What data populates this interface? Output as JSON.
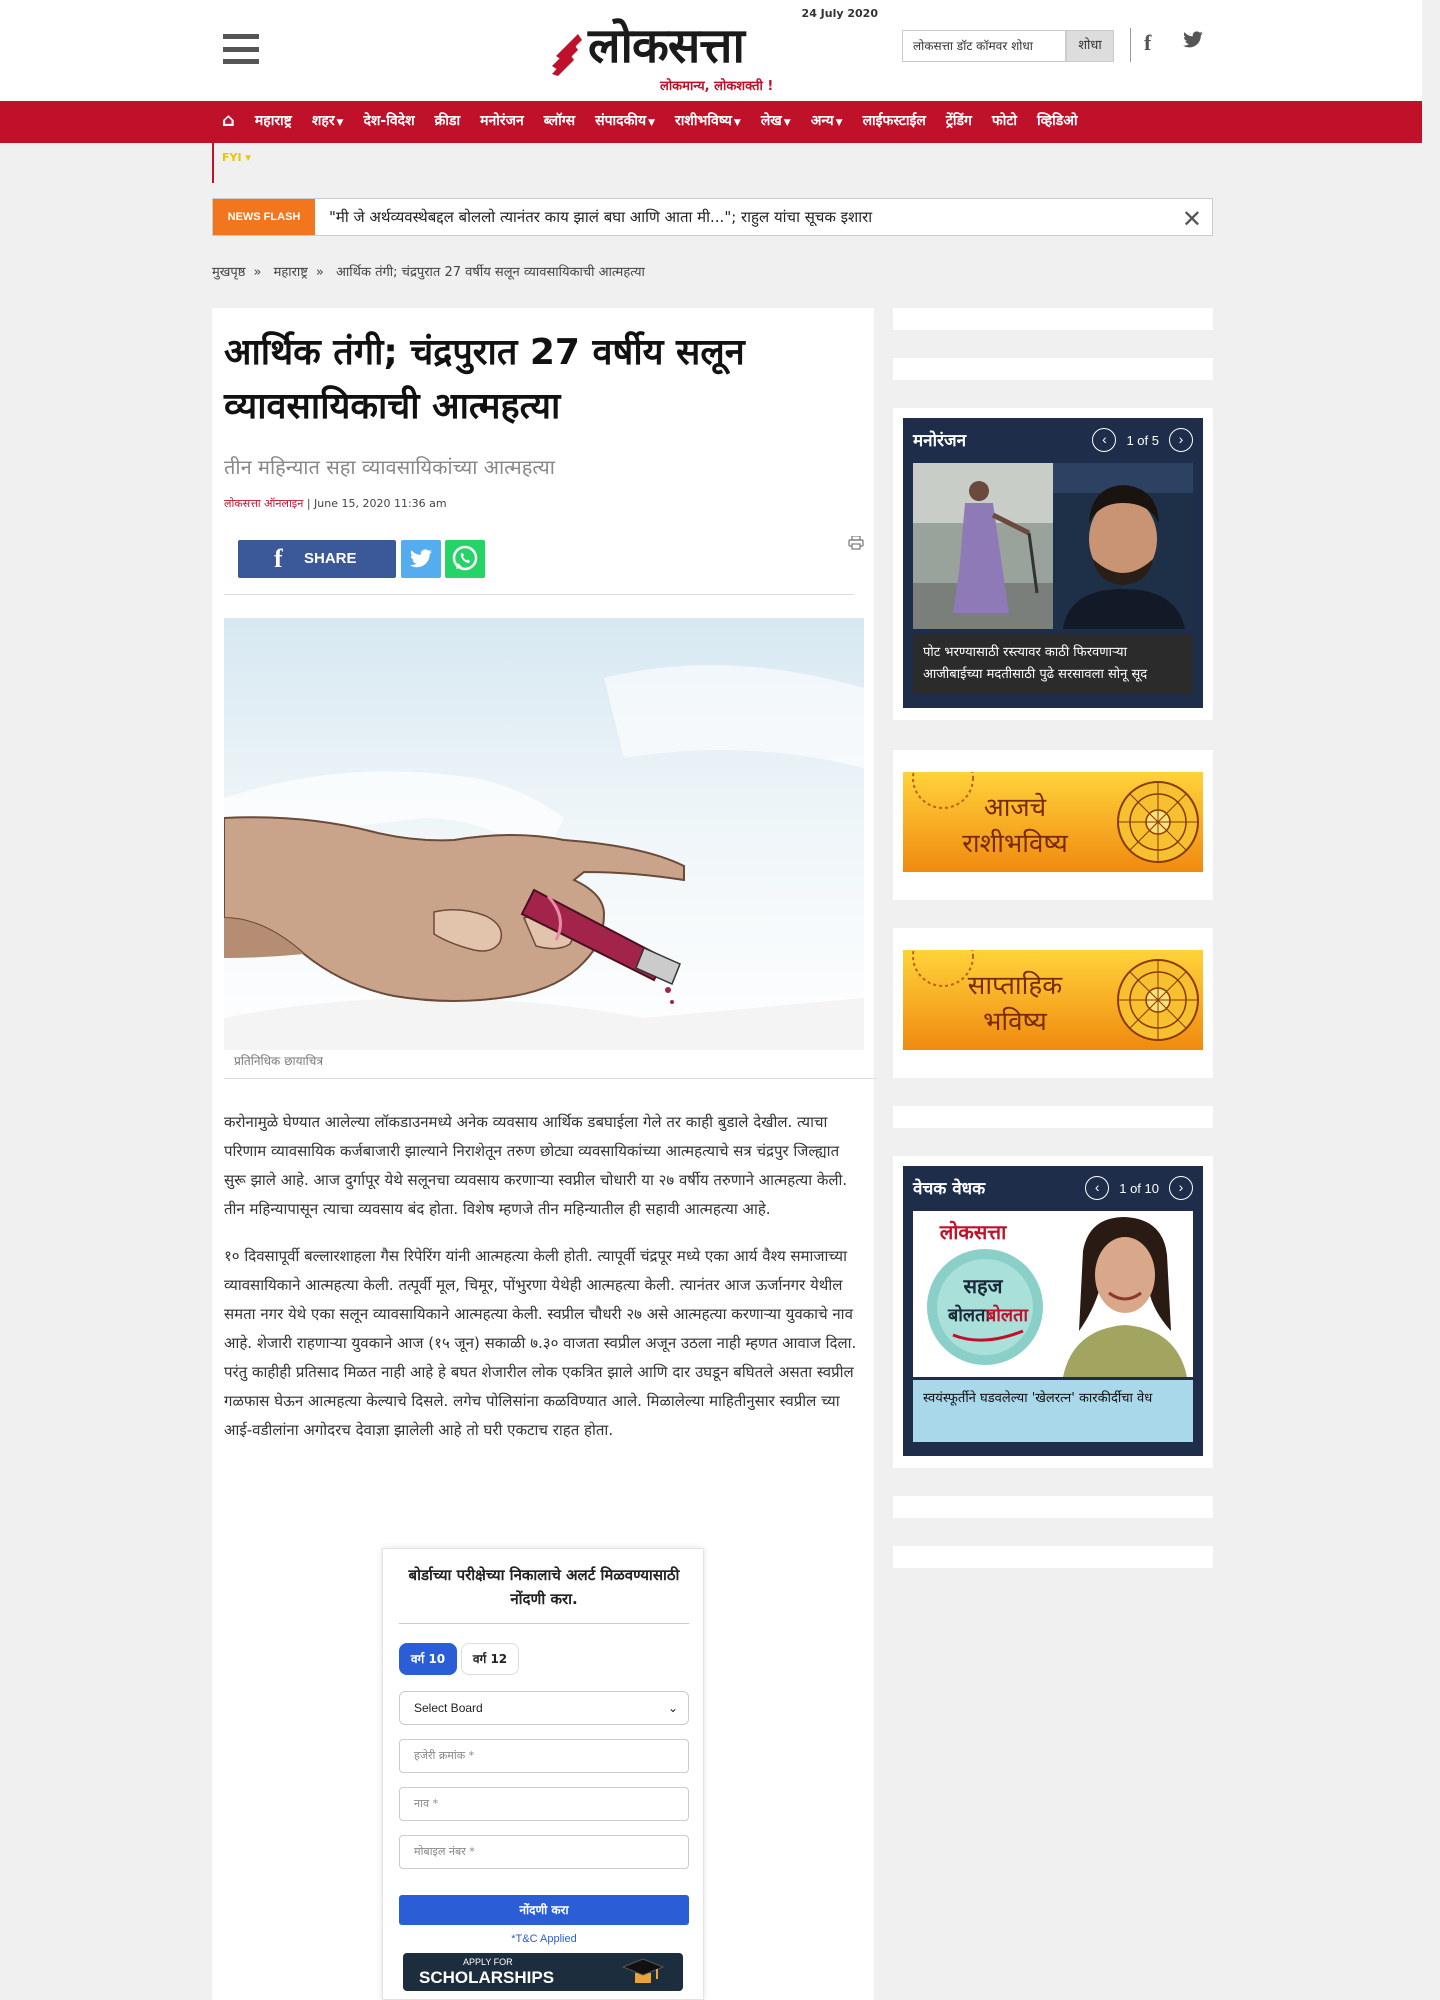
{
  "header": {
    "date": "24 July 2020",
    "logo_text": "लोकसत्ता",
    "tagline": "लोकमान्य, लोकशक्ती !",
    "search_placeholder": "लोकसत्ता डॉट कॉमवर शोधा",
    "search_button": "शोधा",
    "social": [
      "facebook-icon",
      "twitter-icon"
    ]
  },
  "nav": {
    "items": [
      {
        "label": "महाराष्ट्र",
        "caret": false
      },
      {
        "label": "शहर",
        "caret": true
      },
      {
        "label": "देश-विदेश",
        "caret": false
      },
      {
        "label": "क्रीडा",
        "caret": false
      },
      {
        "label": "मनोरंजन",
        "caret": false
      },
      {
        "label": "ब्लॉग्स",
        "caret": false
      },
      {
        "label": "संपादकीय",
        "caret": true
      },
      {
        "label": "राशीभविष्य",
        "caret": true
      },
      {
        "label": "लेख",
        "caret": true
      },
      {
        "label": "अन्य",
        "caret": true
      },
      {
        "label": "लाईफस्टाईल",
        "caret": false
      },
      {
        "label": "ट्रेंडिंग",
        "caret": false
      },
      {
        "label": "फोटो",
        "caret": false
      },
      {
        "label": "व्हिडिओ",
        "caret": false
      }
    ],
    "sub_label": "FYI"
  },
  "newsflash": {
    "label": "NEWS FLASH",
    "text": "\"मी जे अर्थव्यवस्थेबद्दल बोललो त्यानंतर काय झालं बघा आणि आता मी...\"; राहुल यांचा सूचक इशारा"
  },
  "breadcrumb": [
    "मुखपृष्ठ",
    "महाराष्ट्र",
    "आर्थिक तंगी; चंद्रपुरात 27 वर्षीय सलून व्यावसायिकाची आत्महत्या"
  ],
  "article": {
    "headline": "आर्थिक तंगी; चंद्रपुरात 27 वर्षीय सलून व्यावसायिकाची आत्महत्या",
    "subhead": "तीन महिन्यात सहा व्यावसायिकांच्या आत्महत्या",
    "author": "लोकसत्ता ऑनलाइन",
    "date": "| June 15, 2020 11:36 am",
    "share_label": "SHARE",
    "image_caption": "प्रतिनिधिक छायाचित्र",
    "paragraphs": [
      "करोनामुळे घेण्यात आलेल्या लॉकडाउनमध्ये अनेक व्यवसाय आर्थिक डबघाईला गेले तर काही बुडाले देखील. त्याचा परिणाम व्यावसायिक कर्जबाजारी झाल्याने निराशेतून तरुण छोट्या व्यवसायिकांच्या आत्महत्याचे सत्र चंद्रपुर जिल्ह्यात सुरू झाले आहे. आज दुर्गापूर येथे सलूनचा व्यवसाय करणाऱ्या स्वप्नील चोधारी या २७ वर्षीय तरुणाने आत्महत्या केली. तीन महिन्यापासून त्याचा व्यवसाय बंद होता. विशेष म्हणजे तीन महिन्यातील ही सहावी आत्महत्या आहे.",
      "१० दिवसापूर्वी बल्लारशाहला गैस रिपेरिंग यांनी आत्महत्या केली होती. त्यापूर्वी चंद्रपूर मध्ये एका आर्य वैश्य समाजाच्या व्यावसायिकाने आत्महत्या केली. तत्पूर्वी मूल, चिमूर, पोंभुरणा येथेही आत्महत्या केली. त्यानंतर आज ऊर्जानगर येथील समता नगर येथे एका सलून व्यावसायिकाने आत्महत्या केली. स्वप्रील चौधरी २७ असे आत्महत्या करणाऱ्या युवकाचे नाव आहे. शेजारी राहणाऱ्या युवकाने आज (१५ जून) सकाळी ७.३० वाजता स्वप्रील अजून उठला नाही म्हणत आवाज दिला. परंतु काहीही प्रतिसाद मिळत नाही आहे हे बघत शेजारील लोक एकत्रित झाले आणि दार उघडून बघितले असता स्वप्रील गळफास घेऊन आत्महत्या केल्याचे दिसले. लगेच पोलिसांना कळविण्यात आले. मिळालेल्या माहितीनुसार स्वप्रील च्या आई-वडीलांना अगोदरच देवाज्ञा झालेली आहे तो घरी एकटाच राहत होता."
    ]
  },
  "board_widget": {
    "title": "बोर्डाच्या परीक्षेच्या निकालाचे अलर्ट मिळवण्यासाठी नोंदणी करा.",
    "tab_10": "वर्ग 10",
    "tab_12": "वर्ग 12",
    "select_label": "Select Board",
    "roll_placeholder": "हजेरी क्रमांक *",
    "name_placeholder": "नाव *",
    "mobile_placeholder": "मोबाइल  नंबर *",
    "submit_label": "नोंदणी करा",
    "tnc": "*T&C Applied",
    "scholar_top": "APPLY FOR",
    "scholar_main": "SCHOLARSHIPS"
  },
  "sidebar": {
    "entertainment": {
      "title": "मनोरंजन",
      "counter": "1 of 5",
      "caption": "पोट भरण्यासाठी रस्त्यावर काठी फिरवणाऱ्या आजीबाईच्या मदतीसाठी पुढे सरसावला सोनू सूद"
    },
    "rashi_today": [
      "आजचे",
      "राशीभविष्य"
    ],
    "rashi_week": [
      "साप्ताहिक",
      "भविष्य"
    ],
    "vedhak": {
      "title": "वेचक वेधक",
      "counter": "1 of 10",
      "image_logo": "लोकसत्ता",
      "image_bubble": [
        "सहज",
        "बोलता",
        "बोलता"
      ],
      "caption": "स्वयंस्फूर्तीने घडवलेल्या 'खेलरत्न' कारकीर्दीचा वेध"
    }
  },
  "colors": {
    "brand_red": "#c0112b",
    "newsflash_orange": "#f1761d",
    "facebook": "#3b5998",
    "twitter": "#55acee",
    "whatsapp": "#25d366",
    "widget_navy": "#1d2d4a",
    "button_blue": "#2b5ed6"
  }
}
